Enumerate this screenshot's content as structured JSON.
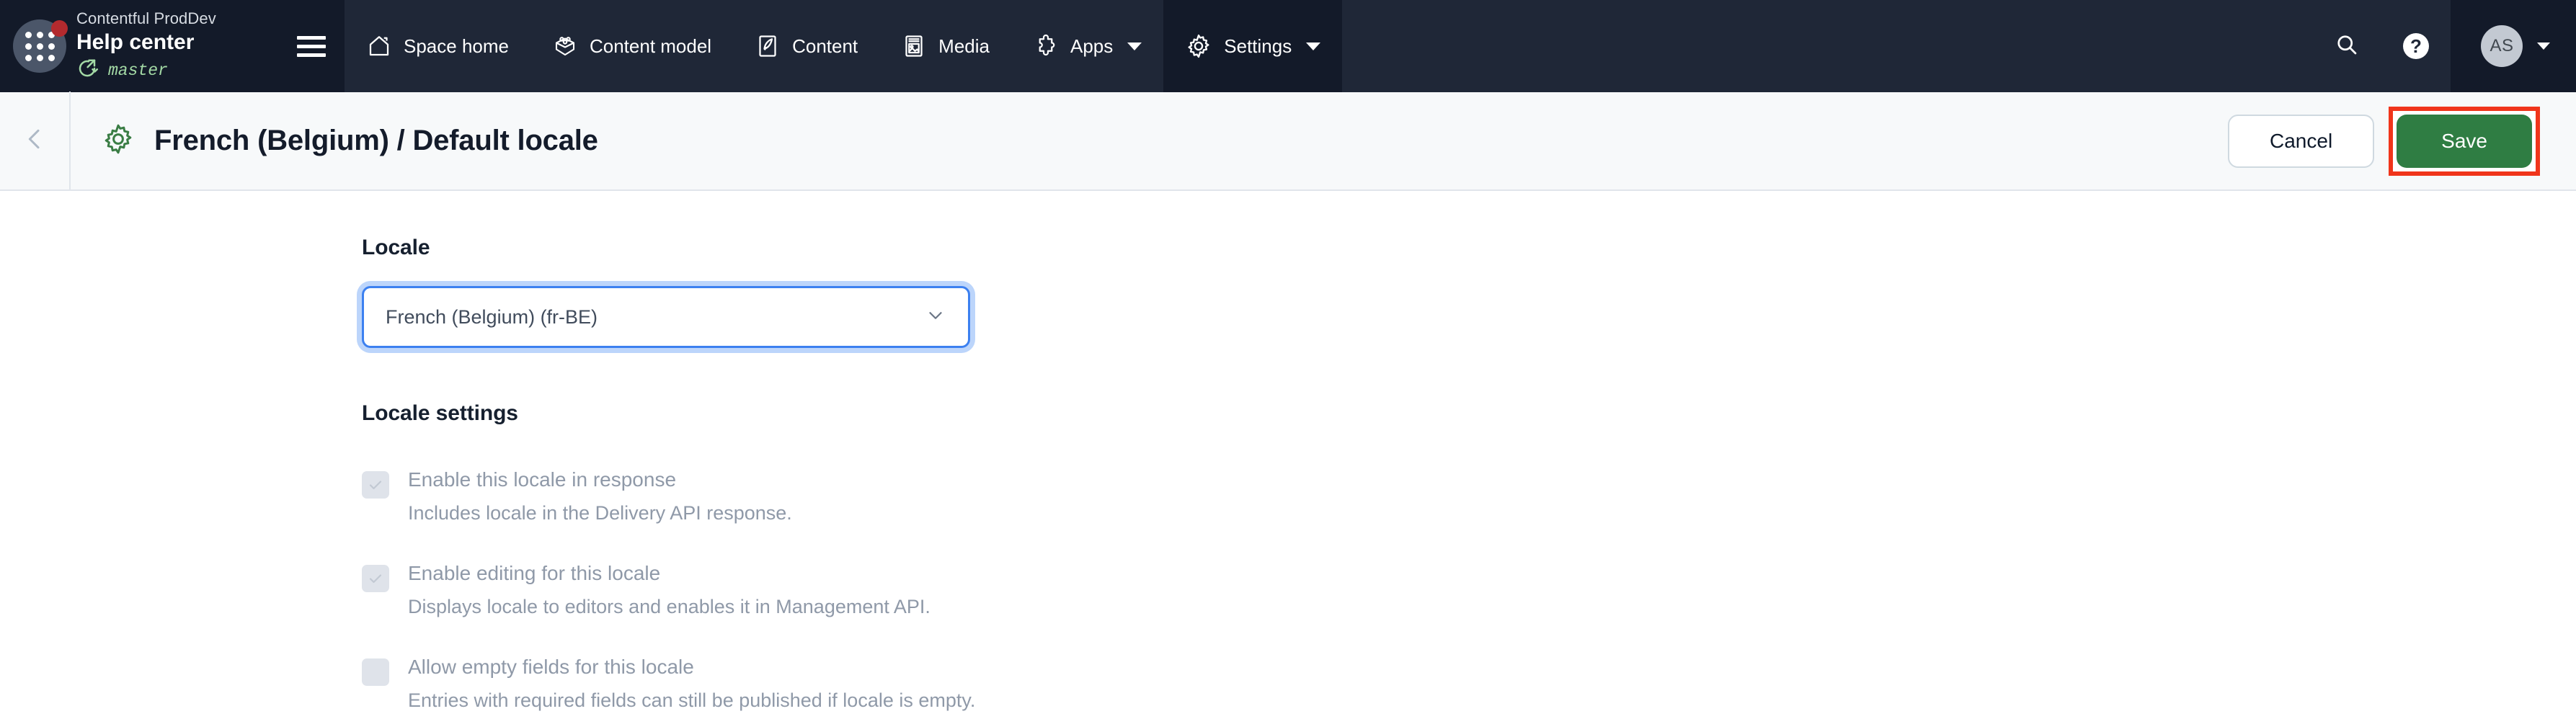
{
  "topbar": {
    "org_name": "Contentful ProdDev",
    "space_name": "Help center",
    "branch": "master",
    "app_launcher_icon": "app-grid-icon",
    "branch_icon": "release-arrow-icon",
    "hamburger_icon": "hamburger-menu-icon",
    "nav_items": [
      {
        "label": "Space home",
        "icon": "home-icon",
        "has_caret": false,
        "active": false
      },
      {
        "label": "Content model",
        "icon": "content-model-blocks-icon",
        "has_caret": false,
        "active": false
      },
      {
        "label": "Content",
        "icon": "content-pencil-icon",
        "has_caret": false,
        "active": false
      },
      {
        "label": "Media",
        "icon": "media-image-icon",
        "has_caret": false,
        "active": false
      },
      {
        "label": "Apps",
        "icon": "puzzle-piece-icon",
        "has_caret": true,
        "active": false
      },
      {
        "label": "Settings",
        "icon": "gear-icon",
        "has_caret": true,
        "active": true
      }
    ],
    "search_icon": "search-icon",
    "help_icon": "help-question-icon",
    "help_glyph": "?",
    "avatar_initials": "AS",
    "account_caret_icon": "chevron-down-icon"
  },
  "page_header": {
    "back_icon": "chevron-left-icon",
    "title_icon": "gear-icon",
    "title": "French (Belgium) / Default locale",
    "cancel_label": "Cancel",
    "save_label": "Save",
    "save_highlight_color": "#f0351b",
    "save_button_color": "#2f7d43"
  },
  "main": {
    "locale_section_title": "Locale",
    "locale_select": {
      "value": "French (Belgium) (fr-BE)",
      "chevron_icon": "chevron-down-icon",
      "focus_ring_color": "#3c80f0"
    },
    "settings_section_title": "Locale settings",
    "checkboxes": [
      {
        "label": "Enable this locale in response",
        "help": "Includes locale in the Delivery API response.",
        "checked": true,
        "disabled": true
      },
      {
        "label": "Enable editing for this locale",
        "help": "Displays locale to editors and enables it in Management API.",
        "checked": true,
        "disabled": true
      },
      {
        "label": "Allow empty fields for this locale",
        "help": "Entries with required fields can still be published if locale is empty.",
        "checked": false,
        "disabled": true
      }
    ]
  }
}
